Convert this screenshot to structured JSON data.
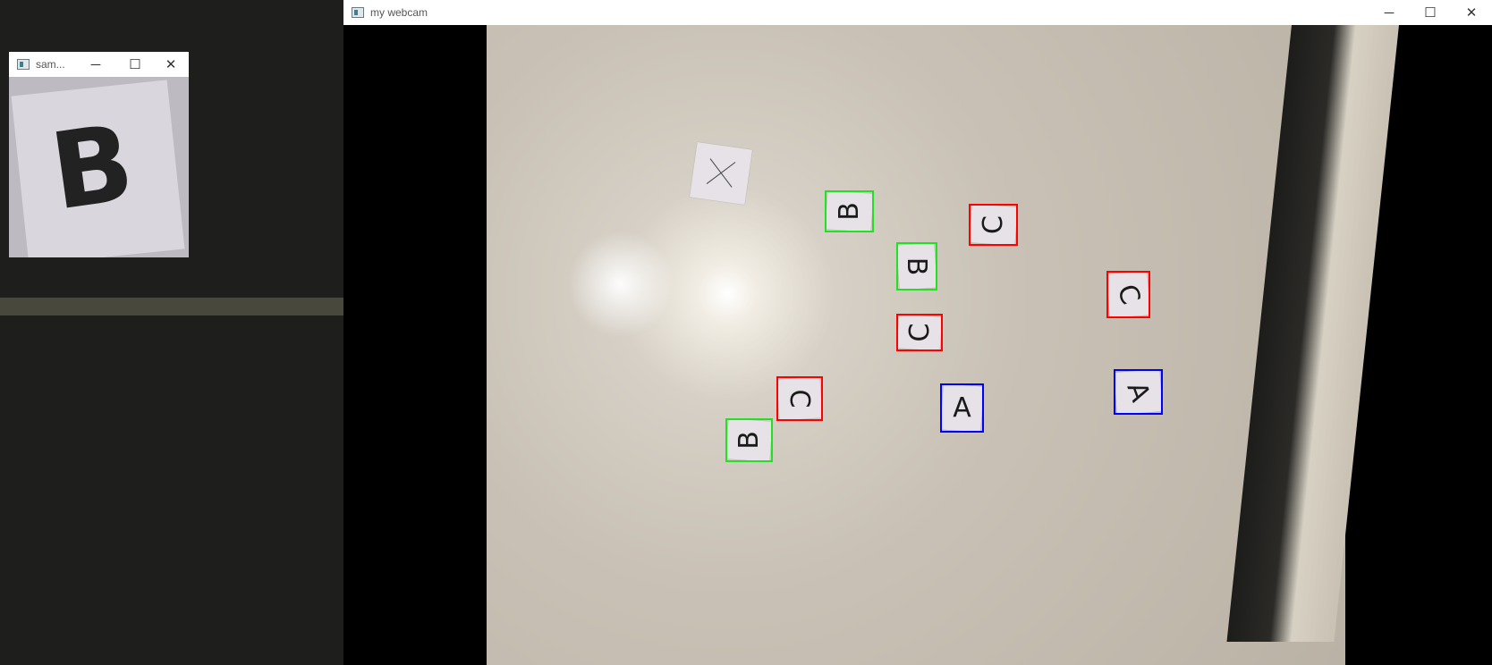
{
  "sample_window": {
    "title": "sam...",
    "preview_letter": "B",
    "controls": {
      "minimize": "─",
      "maximize": "☐",
      "close": "✕"
    }
  },
  "webcam_window": {
    "title": "my webcam",
    "controls": {
      "minimize": "─",
      "maximize": "☐",
      "close": "✕"
    }
  },
  "detections": [
    {
      "letter": "B",
      "color": "#22e022",
      "rotation": -90
    },
    {
      "letter": "C",
      "color": "#ff0000",
      "rotation": -90
    },
    {
      "letter": "B",
      "color": "#22e022",
      "rotation": 90
    },
    {
      "letter": "C",
      "color": "#ff0000",
      "rotation": -90
    },
    {
      "letter": "C",
      "color": "#ff0000",
      "rotation": 90
    },
    {
      "letter": "C",
      "color": "#ff0000",
      "rotation": 70
    },
    {
      "letter": "A",
      "color": "#0000ff",
      "rotation": 0
    },
    {
      "letter": "A",
      "color": "#0000ff",
      "rotation": 70
    },
    {
      "letter": "B",
      "color": "#22e022",
      "rotation": -90
    }
  ]
}
